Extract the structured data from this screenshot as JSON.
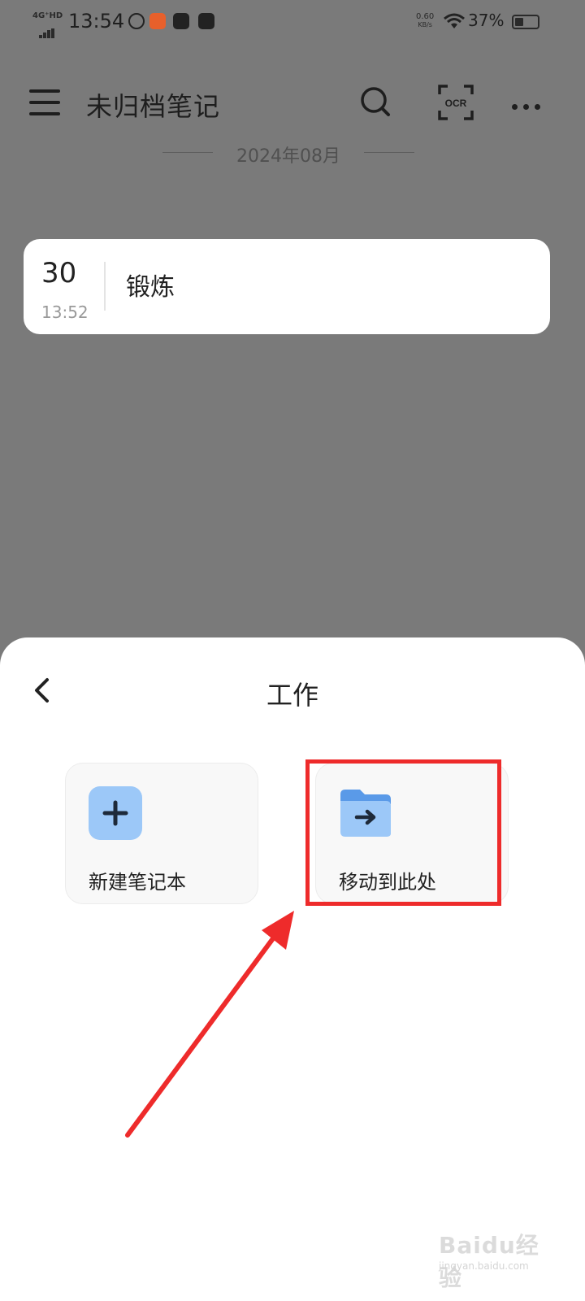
{
  "status_bar": {
    "network": "4G⁺HD",
    "time": "13:54",
    "speed_value": "0.60",
    "speed_unit": "KB/s",
    "battery": "37%",
    "battery_level": 0.37
  },
  "header": {
    "title": "未归档笔记",
    "icons": [
      "menu-icon",
      "search-icon",
      "ocr-icon",
      "more-icon"
    ]
  },
  "date_group": {
    "label": "2024年08月"
  },
  "notes": [
    {
      "day": "30",
      "time": "13:52",
      "title": "锻炼"
    }
  ],
  "sheet": {
    "title": "工作",
    "options": [
      {
        "label": "新建笔记本",
        "icon": "plus-icon"
      },
      {
        "label": "移动到此处",
        "icon": "folder-move-icon"
      }
    ]
  },
  "watermark": {
    "brand": "Baidu经验",
    "sub": "jingyan.baidu.com"
  },
  "colors": {
    "overlay": "#7a7a7a",
    "card": "#ffffff",
    "tile_icon": "#9cc8f8",
    "highlight": "#ee2b2b"
  }
}
